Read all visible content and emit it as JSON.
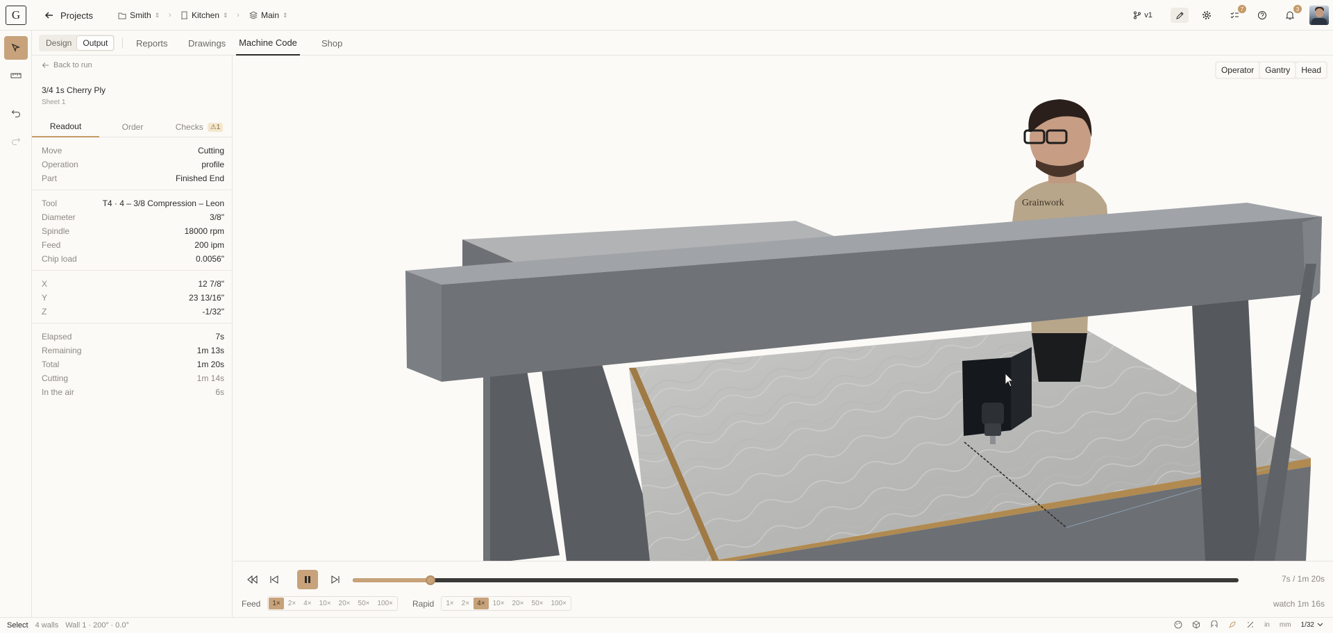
{
  "app": {
    "logo_text": "G",
    "back_label": "Projects",
    "breadcrumbs": [
      {
        "icon": "folder-icon",
        "label": "Smith"
      },
      {
        "icon": "room-icon",
        "label": "Kitchen"
      },
      {
        "icon": "layers-icon",
        "label": "Main"
      }
    ],
    "version_label": "v1",
    "tasks_badge": "7",
    "notifications_badge": "3"
  },
  "mode_toggle": {
    "design": "Design",
    "output": "Output",
    "selected": "Output"
  },
  "nav_tabs": [
    "Reports",
    "Drawings",
    "Machine Code",
    "Shop"
  ],
  "nav_active": "Machine Code",
  "panel": {
    "back_label": "Back to run",
    "material": "3/4 1s Cherry Ply",
    "sheet": "Sheet 1",
    "tabs": [
      "Readout",
      "Order",
      "Checks"
    ],
    "checks_warning": "1",
    "active_tab": "Readout",
    "move_section": [
      {
        "k": "Move",
        "v": "Cutting"
      },
      {
        "k": "Operation",
        "v": "profile"
      },
      {
        "k": "Part",
        "v": "Finished End"
      }
    ],
    "tool_section": [
      {
        "k": "Tool",
        "v": "T4 · 4 – 3/8 Compression – Leon"
      },
      {
        "k": "Diameter",
        "v": "3/8\""
      },
      {
        "k": "Spindle",
        "v": "18000 rpm"
      },
      {
        "k": "Feed",
        "v": "200 ipm"
      },
      {
        "k": "Chip load",
        "v": "0.0056\""
      }
    ],
    "position_section": [
      {
        "k": "X",
        "v": "12 7/8\""
      },
      {
        "k": "Y",
        "v": "23 13/16\""
      },
      {
        "k": "Z",
        "v": "-1/32\""
      }
    ],
    "time_section": [
      {
        "k": "Elapsed",
        "v": "7s"
      },
      {
        "k": "Remaining",
        "v": "1m 13s"
      },
      {
        "k": "Total",
        "v": "1m 20s"
      },
      {
        "k": "Cutting",
        "v": "1m 14s"
      },
      {
        "k": "In the air",
        "v": "6s"
      }
    ]
  },
  "viewport": {
    "camera_buttons": [
      "Operator",
      "Gantry",
      "Head"
    ],
    "shirt_text": "Grainwork"
  },
  "playback": {
    "progress": 0.0875,
    "time_label": "7s / 1m 20s",
    "feed_label": "Feed",
    "feed_speeds": [
      "1×",
      "2×",
      "4×",
      "10×",
      "20×",
      "50×",
      "100×"
    ],
    "feed_selected": "1×",
    "rapid_label": "Rapid",
    "rapid_speeds": [
      "1×",
      "2×",
      "4×",
      "10×",
      "20×",
      "50×",
      "100×"
    ],
    "rapid_selected": "4×",
    "watch_label": "watch 1m 16s"
  },
  "status": {
    "mode": "Select",
    "walls": "4 walls",
    "wall_info": "Wall 1 · 200″ · 0.0°",
    "unit_in": "in",
    "unit_mm": "mm",
    "precision": "1/32"
  },
  "colors": {
    "accent": "#c7a27a",
    "text": "#2b2a28",
    "muted": "#8d8981"
  }
}
